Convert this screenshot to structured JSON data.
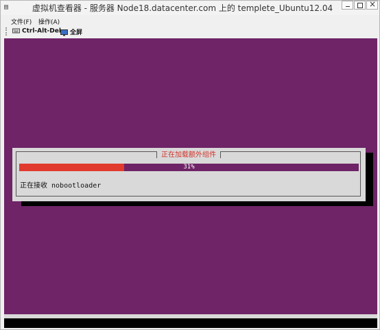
{
  "window": {
    "title": "虚拟机查看器 - 服务器 Node18.datacenter.com 上的 templete_Ubuntu12.04"
  },
  "menu": {
    "file": "文件(F)",
    "operations": "操作(A)"
  },
  "toolbar": {
    "ctrl_alt_del": "Ctrl-Alt-Del",
    "fullscreen": "全屏"
  },
  "installer": {
    "dialog_title": "正在加载额外组件",
    "progress_percent": 31,
    "progress_label": "31%",
    "status_text": "正在接收 nobootloader"
  },
  "colors": {
    "console_bg": "#6e2467",
    "progress_fill": "#e03b2e",
    "dialog_title": "#d0342b",
    "dialog_bg": "#d9d9d9"
  }
}
